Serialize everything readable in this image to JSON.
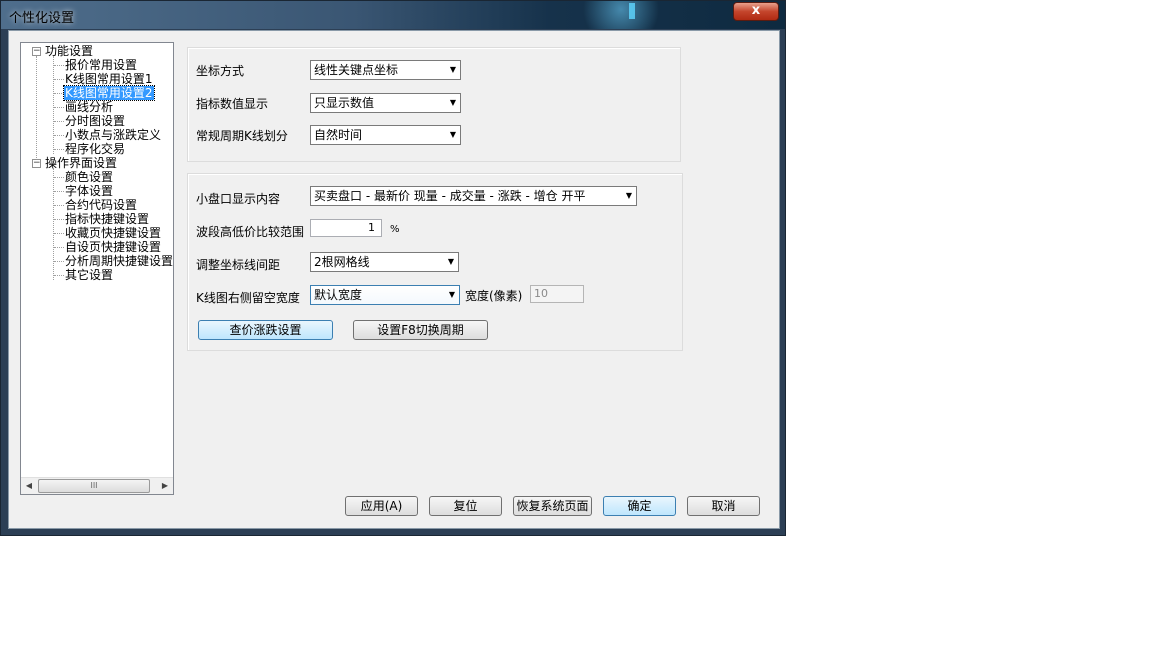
{
  "window": {
    "title": "个性化设置",
    "close_label": "x"
  },
  "tree": {
    "groups": [
      {
        "label": "功能设置",
        "expander": "−",
        "children": [
          "报价常用设置",
          "K线图常用设置1",
          "K线图常用设置2",
          "画线分析",
          "分时图设置",
          "小数点与涨跌定义",
          "程序化交易"
        ]
      },
      {
        "label": "操作界面设置",
        "expander": "−",
        "children": [
          "颜色设置",
          "字体设置",
          "合约代码设置",
          "指标快捷键设置",
          "收藏页快捷键设置",
          "自设页快捷键设置",
          "分析周期快捷键设置",
          "其它设置"
        ]
      }
    ],
    "selected": "K线图常用设置2",
    "scroll_grip": "III"
  },
  "group1": {
    "coord_mode": {
      "label": "坐标方式",
      "value": "线性关键点坐标"
    },
    "indicator_display": {
      "label": "指标数值显示",
      "value": "只显示数值"
    },
    "period_division": {
      "label": "常规周期K线划分",
      "value": "自然时间"
    }
  },
  "group2": {
    "mini_panel": {
      "label": "小盘口显示内容",
      "value": "买卖盘口 - 最新价 现量 - 成交量 - 涨跌 - 增仓 开平"
    },
    "wave_range": {
      "label": "波段高低价比较范围",
      "value": "1",
      "unit": "%"
    },
    "grid_spacing": {
      "label": "调整坐标线间距",
      "value": "2根网格线"
    },
    "right_space": {
      "label": "K线图右侧留空宽度",
      "value": "默认宽度",
      "width_label": "宽度(像素)",
      "width_value": "10"
    },
    "price_limit_button": "查价涨跌设置",
    "f8_button": "设置F8切换周期"
  },
  "footer": {
    "apply": "应用(A)",
    "reset": "复位",
    "restore": "恢复系统页面",
    "ok": "确定",
    "cancel": "取消"
  }
}
